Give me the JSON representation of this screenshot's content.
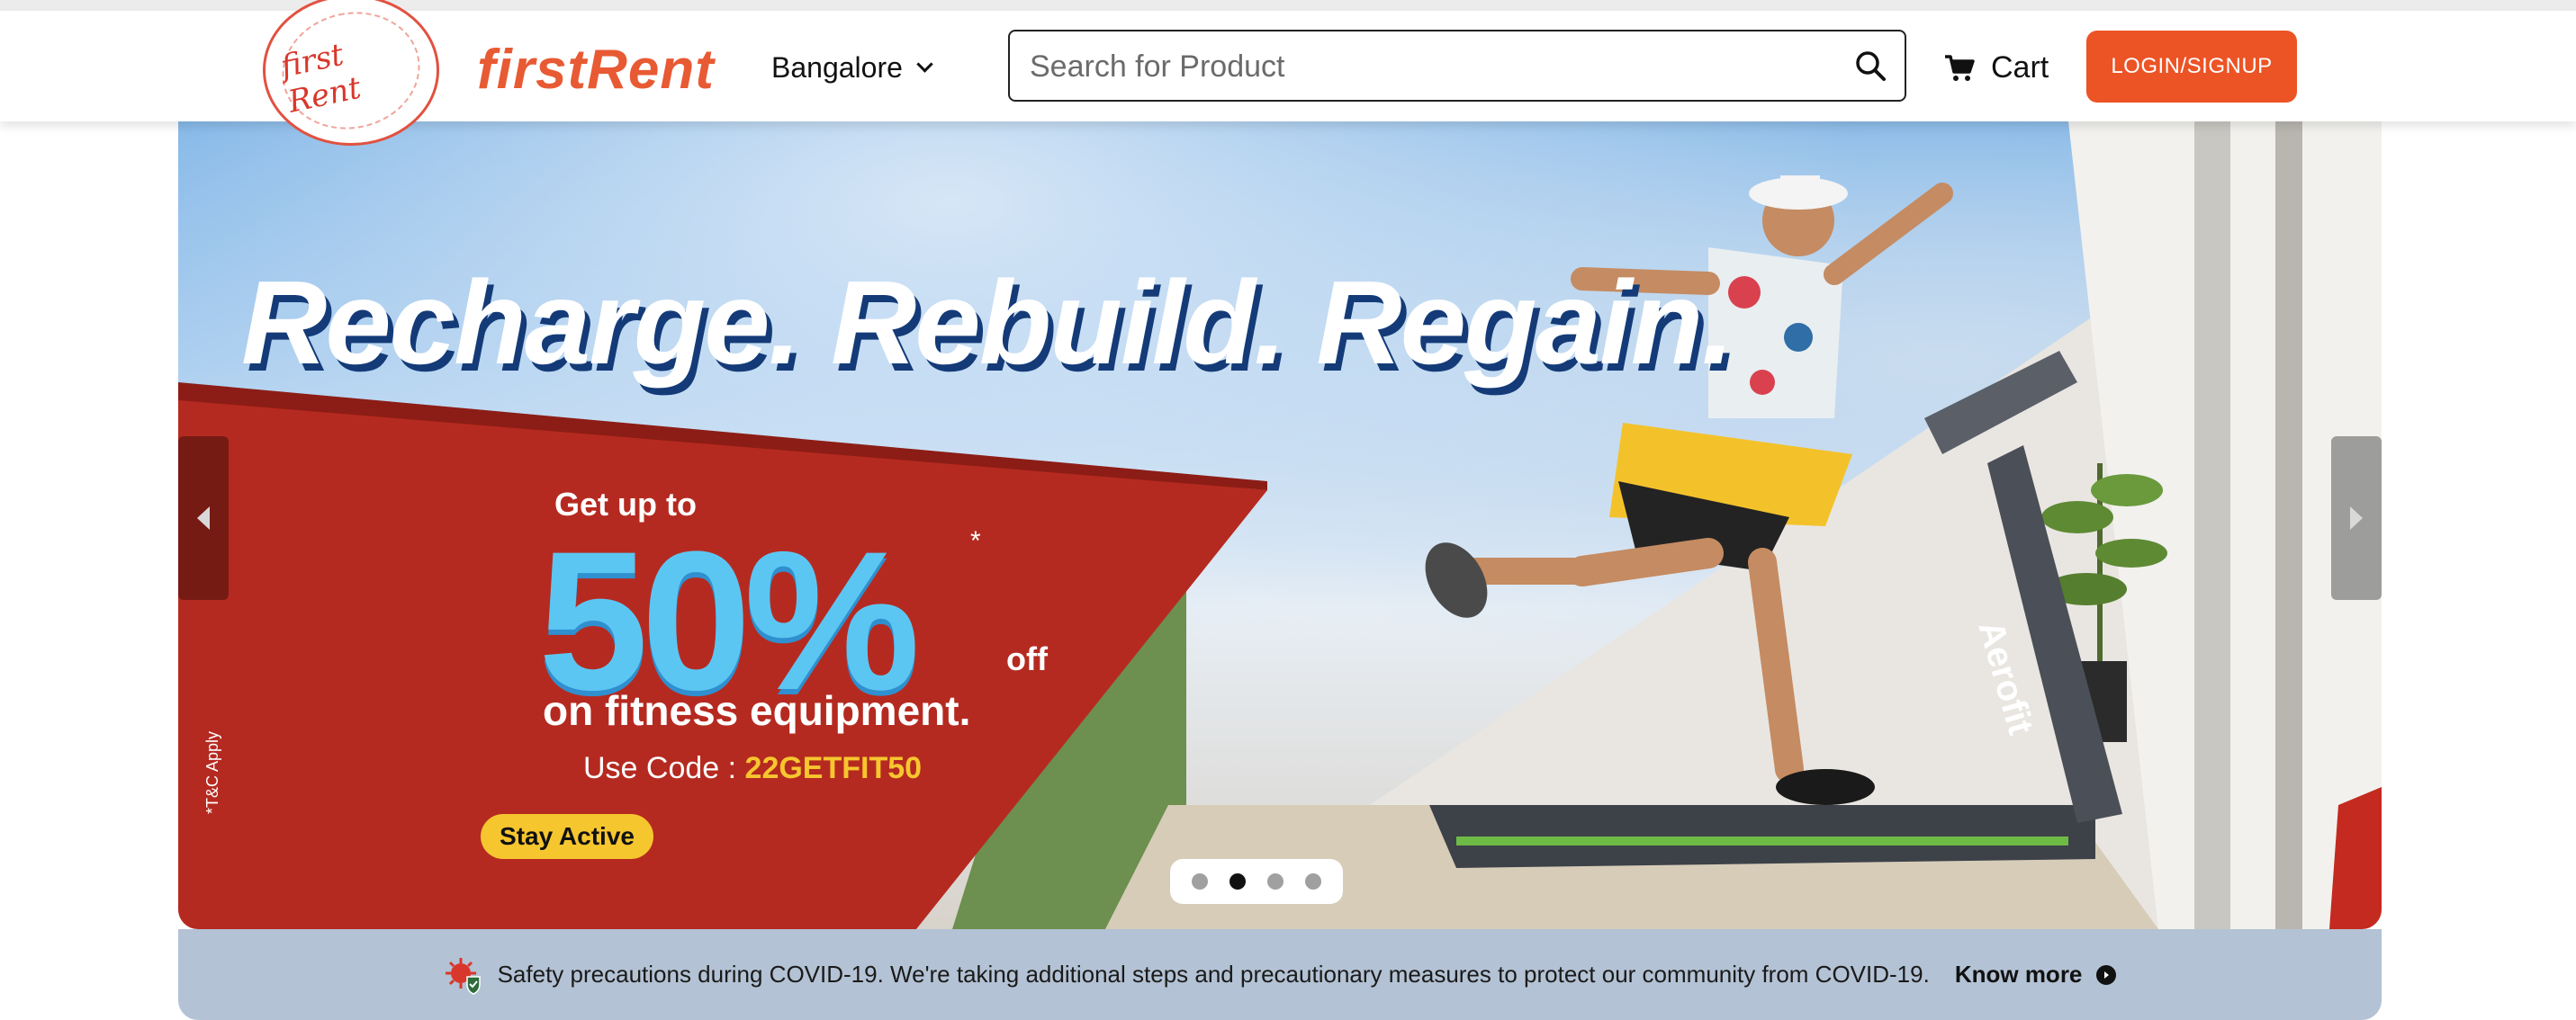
{
  "header": {
    "logo_text": "first Rent",
    "brand": "firstRent",
    "city": "Bangalore",
    "search_placeholder": "Search for Product",
    "cart_label": "Cart",
    "login_label": "LOGIN/SIGNUP"
  },
  "banner": {
    "tagline": "Recharge. Rebuild. Regain.",
    "promo_upto": "Get up to",
    "promo_percent": "50%",
    "promo_asterisk": "*",
    "promo_off": "off",
    "promo_line2": "on fitness equipment.",
    "promo_code_label": "Use Code : ",
    "promo_code": "22GETFIT50",
    "cta": "Stay Active",
    "tc": "*T&C Apply",
    "treadmill_brand": "Aerofit",
    "slides": 4,
    "active_slide": 2
  },
  "notice": {
    "message": "Safety precautions during COVID-19. We're taking additional steps and precautionary measures to protect our community from COVID-19.",
    "link_label": "Know more"
  },
  "colors": {
    "brand_orange": "#ec5325",
    "promo_red": "#c42a1f",
    "promo_blue": "#5cc6f2",
    "promo_yellow": "#f6c62f",
    "notice_bg": "#b3c2d4"
  }
}
